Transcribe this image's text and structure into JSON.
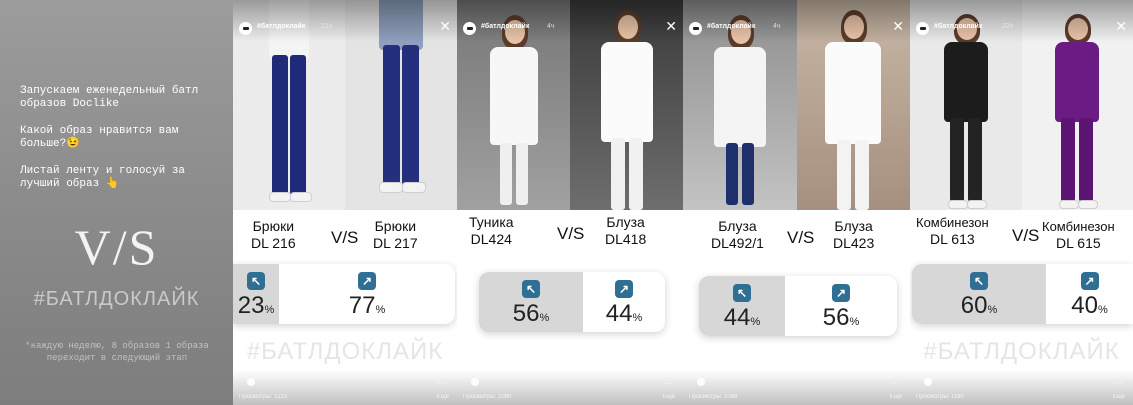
{
  "intro": {
    "text1": "Запускаем еженедельный батл\nобразов Doclike",
    "text2": "Какой образ нравится вам\nбольше?😉",
    "text3": "Листай ленту и голосуй за\nлучший образ 👆",
    "vs": "V/S",
    "hashtag": "#БАТЛДОКЛАЙК",
    "footer": "*каждую неделю, 8 образов 1\nобраза переходит в следующий\nэтап"
  },
  "stories": [
    {
      "account": "#батлдоклайк",
      "time": "21ч",
      "left": {
        "name": "Брюки",
        "code": "DL 216",
        "pct": "23",
        "bg": "#eeeeee",
        "top": "#f5f5f5",
        "bottom": "#1f2a78"
      },
      "right": {
        "name": "Брюки",
        "code": "DL 217",
        "pct": "77",
        "bg": "#e6e6e6",
        "top": "#8da0bd",
        "bottom": "#24307d"
      },
      "vs": "V/S",
      "selected": "left",
      "pct_unit": "%",
      "hashtag": "#БАТЛДОКЛАЙК",
      "views": "Просмотры: 1223",
      "delete": "Ещё"
    },
    {
      "account": "#батлдоклайк",
      "time": "4ч",
      "left": {
        "name": "Туника",
        "code": "DL424",
        "pct": "56",
        "bg": "#8d8d8d",
        "top": "#f7f7f7",
        "bottom": "#f2f2f2"
      },
      "right": {
        "name": "Блуза",
        "code": "DL418",
        "pct": "44",
        "bg": "#5f5f5f",
        "top": "#fafafa",
        "bottom": "#f1f1f1"
      },
      "vs": "V/S",
      "selected": "left",
      "pct_unit": "%",
      "hashtag": "",
      "views": "Просмотры: 1080",
      "delete": "Ещё"
    },
    {
      "account": "#батлдоклайк",
      "time": "4ч",
      "left": {
        "name": "Блуза",
        "code": "DL492/1",
        "pct": "44",
        "bg": "#a9a9a9",
        "top": "#f4f4f4",
        "bottom": "#1e2f6b"
      },
      "right": {
        "name": "Блуза",
        "code": "DL423",
        "pct": "56",
        "bg": "#b9a99a",
        "top": "#fbfbfb",
        "bottom": "#f3f3f3"
      },
      "vs": "V/S",
      "selected": "left",
      "pct_unit": "%",
      "hashtag": "",
      "views": "Просмотры: 1068",
      "delete": "Ещё"
    },
    {
      "account": "#батлдоклайк",
      "time": "22ч",
      "left": {
        "name": "Комбинезон",
        "code": "DL 613",
        "pct": "60",
        "bg": "#e9e9e9",
        "top": "#1c1c1c",
        "bottom": "#232323"
      },
      "right": {
        "name": "Комбинезон",
        "code": "DL 615",
        "pct": "40",
        "bg": "#f0f0f0",
        "top": "#6b1c84",
        "bottom": "#5d1573"
      },
      "vs": "V/S",
      "selected": "left",
      "pct_unit": "%",
      "hashtag": "#БАТЛДОКЛАЙК",
      "views": "Просмотры: 1180",
      "delete": "Ещё"
    }
  ],
  "icons": {
    "arrow_left": "↖",
    "arrow_right": "↗",
    "close": "✕",
    "more": "···"
  }
}
